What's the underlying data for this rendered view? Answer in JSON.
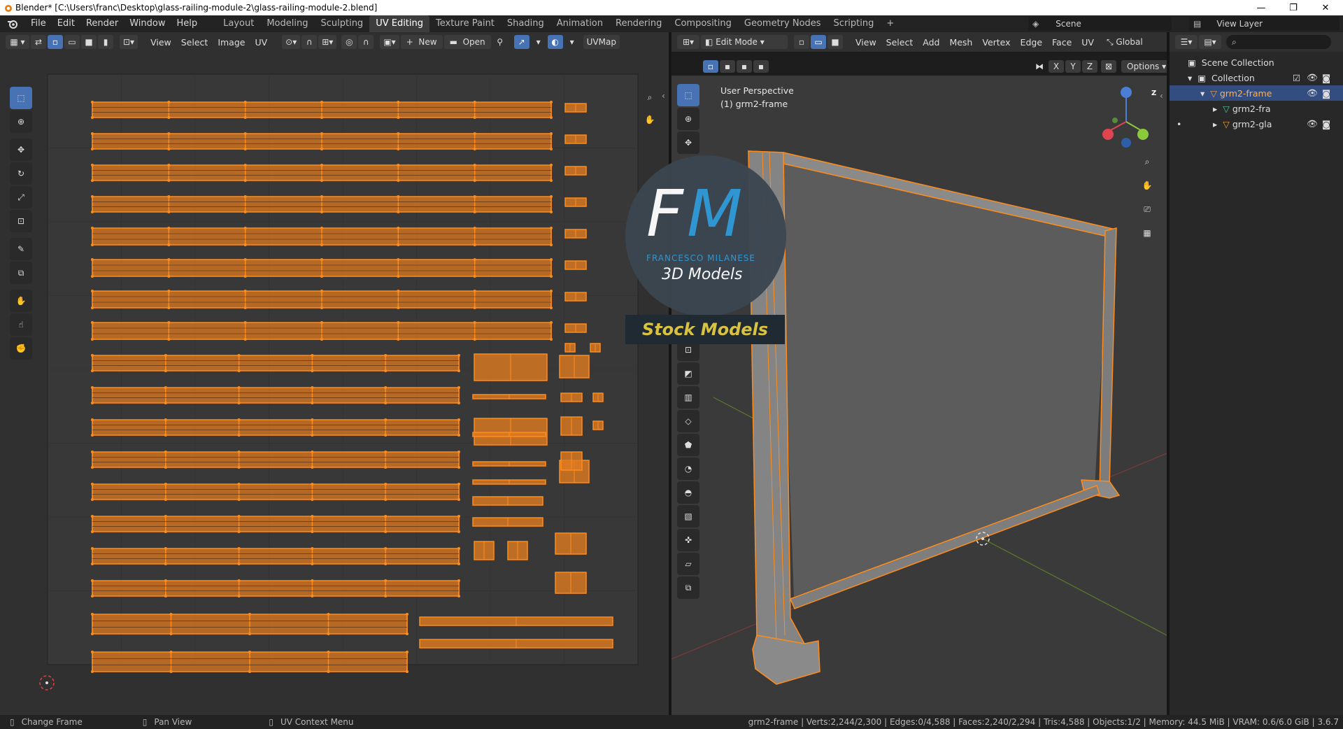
{
  "window": {
    "title": "Blender* [C:\\Users\\franc\\Desktop\\glass-railing-module-2\\glass-railing-module-2.blend]",
    "minimize": "—",
    "restore": "❐",
    "close": "✕"
  },
  "menu": {
    "items": [
      "File",
      "Edit",
      "Render",
      "Window",
      "Help"
    ],
    "workspaces": [
      "Layout",
      "Modeling",
      "Sculpting",
      "UV Editing",
      "Texture Paint",
      "Shading",
      "Animation",
      "Rendering",
      "Compositing",
      "Geometry Nodes",
      "Scripting"
    ],
    "active_workspace": "UV Editing",
    "add_workspace": "+",
    "scene": "Scene",
    "view_layer": "View Layer"
  },
  "uv_editor": {
    "menus": [
      "View",
      "Select",
      "Image",
      "UV"
    ],
    "new_label": "New",
    "open_label": "Open",
    "uvmap_label": "UVMap"
  },
  "viewport": {
    "mode": "Edit Mode",
    "menus": [
      "View",
      "Select",
      "Add",
      "Mesh",
      "Vertex",
      "Edge",
      "Face",
      "UV"
    ],
    "orientation": "Global",
    "options_label": "Options",
    "axes": [
      "X",
      "Y",
      "Z"
    ],
    "perspective": "User Perspective",
    "object_label": "(1) grm2-frame",
    "gizmo_z": "Z"
  },
  "watermark": {
    "initials_f": "F",
    "initials_m": "M",
    "brand": "FRANCESCO MILANESE",
    "subtitle": "3D Models",
    "banner": "Stock Models"
  },
  "outliner": {
    "rows": [
      {
        "label": "Scene Collection"
      },
      {
        "label": "Collection"
      },
      {
        "label": "grm2-frame"
      },
      {
        "label": "grm2-fra"
      },
      {
        "label": "grm2-gla"
      }
    ]
  },
  "statusbar": {
    "items": [
      "Change Frame",
      "Pan View",
      "UV Context Menu"
    ],
    "stats": "grm2-frame | Verts:2,244/2,300 | Edges:0/4,588 | Faces:2,240/2,294 | Tris:4,588 | Objects:1/2 | Memory: 44.5 MiB | VRAM: 0.6/6.0 GiB | 3.6.7"
  },
  "colors": {
    "accent": "#4772b3",
    "uv_orange": "#e07a1f",
    "selected_edge": "#ff8c1a",
    "grid_bg": "#383838"
  }
}
